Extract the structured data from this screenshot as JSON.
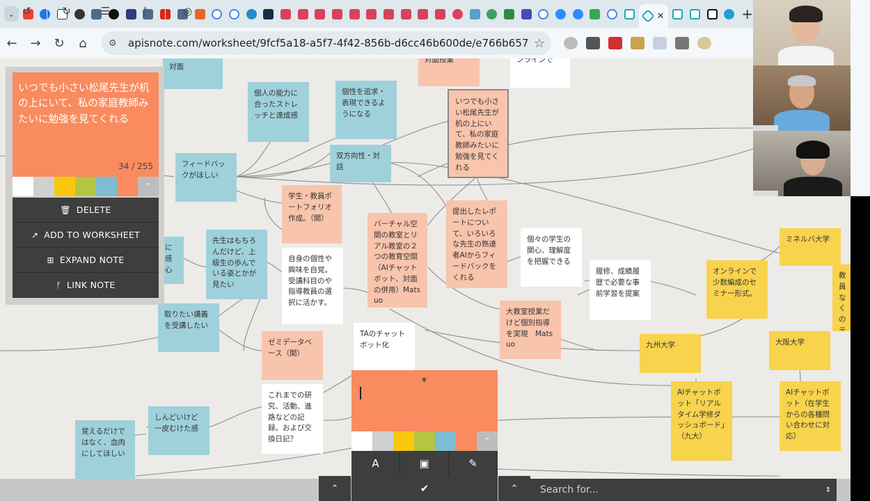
{
  "browser": {
    "url": "apisnote.com/worksheet/9fcf5a18-a5f7-4f42-856b-d6cc46b600de/e766b657-1ad2-4bcd-a7c5...",
    "tab_close": "✕",
    "new_tab": "+"
  },
  "edit_panel": {
    "note_text": "いつでも小さい松尾先生が机の上にいて、私の家庭教師みたいに勉強を見てくれる",
    "char_count": "34 / 255",
    "actions": {
      "delete": "DELETE",
      "add_to_worksheet": "ADD TO WORKSHEET",
      "expand_note": "EXPAND NOTE",
      "link_note": "LINK NOTE"
    }
  },
  "notes": {
    "n_taimen": "対面",
    "n_top_salmon": "対面授業",
    "n_top_white": "ンラインで",
    "n_kojin": "個人の能力に合ったストレッチと達成感",
    "n_kosei": "個性を追求・表現できるようになる",
    "n_matsuo": "いつでも小さい松尾先生が机の上にいて、私の家庭教師みたいに勉強を見てくれる",
    "n_feedback": "フィードバックがほしい",
    "n_sohoko": "双方向性・対話",
    "n_portfolio": "学生・教員ポートフォリオ作成。（関）",
    "n_virtual": "バーチャル空間の教室とリアル教室の２つの教育空間（AIチャットボット、対面の併用）Matsuo",
    "n_report": "提出したレポートについて、いろいろな先生の熟達者AIからフィードバックをくれる",
    "n_kanshin": "個々の学生の関心、理解度を把握できる",
    "n_rishu": "履修、成績履歴で必要な事前学習を提案",
    "n_kankan": "に感心",
    "n_sensei": "先生はもちろんだけど、上級生の歩んでいる姿とかが見たい",
    "n_jishin": "自身の個性や興味を自覚。受講科目のや指導教員の選択に活かす。",
    "n_daikyo": "大教室授業だけど個別指導を実現　Matsuo",
    "n_minerva": "ミネルバ大学",
    "n_online": "オンラインで少数編成のセミナー形式。",
    "n_edge": "教員なくのテョン",
    "n_toritai": "取りたい講義を受講したい",
    "n_ta": "TAのチャットボット化",
    "n_kyushu": "九州大学",
    "n_osaka": "大阪大学",
    "n_zemi": "ゼミデータベース（関）",
    "n_korema": "これまでの研究、活動、進路などの記録。および交換日記？",
    "n_ai_kyushu": "AIチャットボット「リアルタイム学修ダッシュボード」（九大）",
    "n_ai_osaka": "AIチャットボット（在学生からの各種問い合わせに対応）",
    "n_shindoi": "しんどいけど一皮むけた感",
    "n_oboeru": "覚えるだけではなく、血肉にしてほしい"
  },
  "bottom": {
    "search_placeholder": "Search for...",
    "confirm": "✔"
  },
  "colors": {
    "teal": "#9fd1db",
    "salmon": "#f9c4ac",
    "white": "#ffffff",
    "yellow": "#f8d34c",
    "orange": "#f98b5f",
    "lightgray": "#d0d0d0",
    "gold": "#f9c80e",
    "olive": "#b5c542",
    "blue": "#7dbcd2",
    "dark": "#3e3e3e"
  }
}
